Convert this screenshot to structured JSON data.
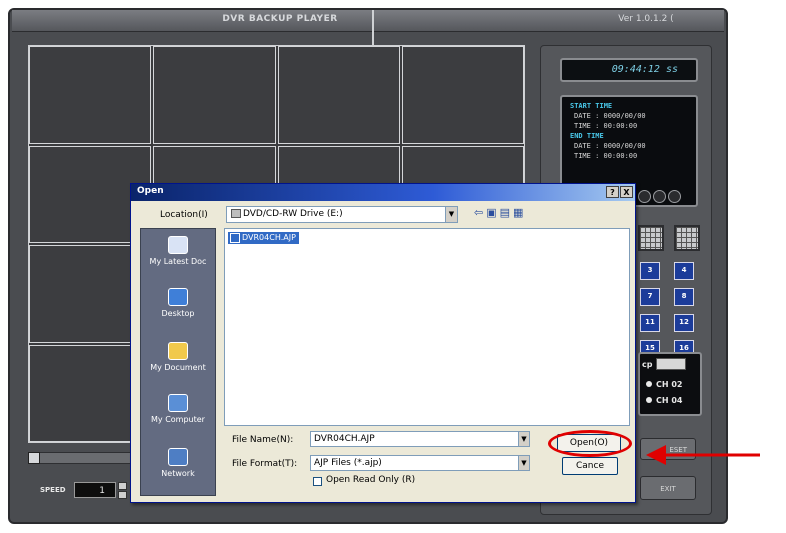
{
  "player": {
    "title": "DVR BACKUP PLAYER",
    "version": "Ver 1.0.1.2 (",
    "clock": "09:44:12 ss",
    "start_time_label": "START TIME",
    "start_date": "DATE : 0000/00/00",
    "start_time": "TIME : 00:00:00",
    "end_time_label": "END TIME",
    "end_date": "DATE : 0000/00/00",
    "end_time": "TIME : 00:00:00",
    "speed_label": "SPEED",
    "speed_value": "1",
    "channel_buttons": [
      "3",
      "4",
      "7",
      "8",
      "11",
      "12",
      "15",
      "16"
    ],
    "ch02": "CH 02",
    "ch04": "CH 04",
    "ch_select_label": "cp",
    "reset_label": "ESET",
    "exit_label": "EXIT",
    "accent_color": "#1c3c9a"
  },
  "dialog": {
    "title": "Open",
    "help": "?",
    "close": "X",
    "location_label": "Location(I)",
    "location_value": "DVD/CD-RW Drive     (E:)",
    "places": [
      {
        "label": "My Latest Doc",
        "icon": "recent-documents-icon"
      },
      {
        "label": "Desktop",
        "icon": "desktop-icon"
      },
      {
        "label": "My Document",
        "icon": "my-documents-icon"
      },
      {
        "label": "My Computer",
        "icon": "my-computer-icon"
      },
      {
        "label": "Network",
        "icon": "network-icon"
      }
    ],
    "file_item": "DVR04CH.AJP",
    "file_name_label": "File Name(N):",
    "file_name_value": "DVR04CH.AJP",
    "file_format_label": "File Format(T):",
    "file_format_value": "AJP Files (*.ajp)",
    "read_only_label": "Open Read Only (R)",
    "open_button": "Open(O)",
    "cancel_button": "Cance",
    "highlight_color": "#e00000"
  }
}
